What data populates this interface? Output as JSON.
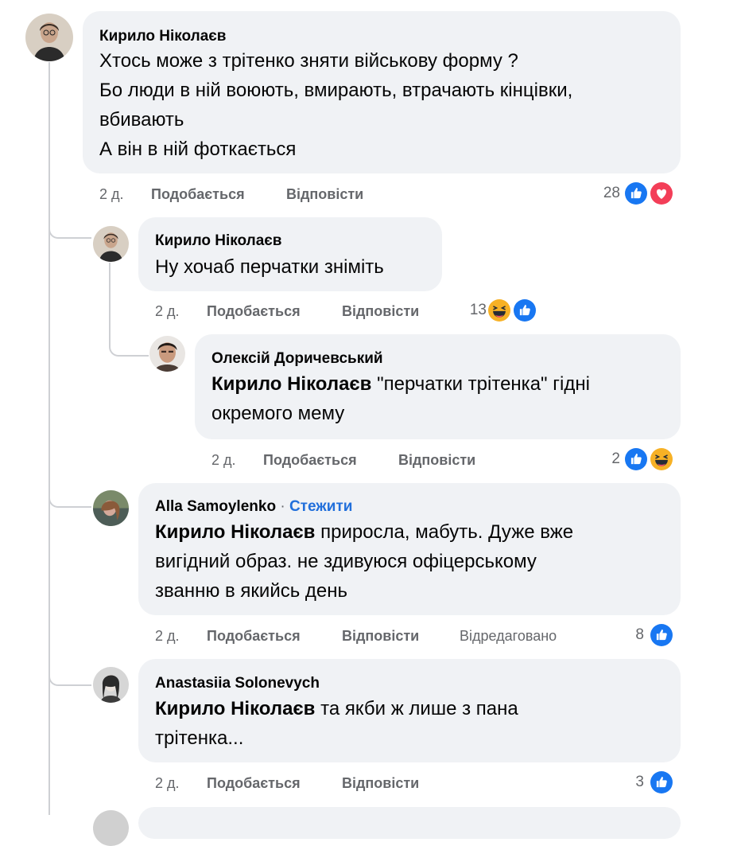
{
  "comments": [
    {
      "author": "Кирило Ніколаєв",
      "lines": [
        "Хтось може з трітенко зняти військову форму ?",
        "Бо люди в ній воюють, вмирають, втрачають кінцівки,",
        "вбивають",
        "А він в ній фоткається"
      ],
      "time": "2 д.",
      "like": "Подобається",
      "reply": "Відповісти",
      "reactions_count": "28",
      "reactions": [
        "like",
        "love"
      ]
    },
    {
      "author": "Кирило Ніколаєв",
      "lines": [
        "Ну хочаб перчатки зніміть"
      ],
      "time": "2 д.",
      "like": "Подобається",
      "reply": "Відповісти",
      "reactions_count": "13",
      "reactions": [
        "haha",
        "like"
      ]
    },
    {
      "author": "Олексій Доричевський",
      "mention": "Кирило Ніколаєв",
      "lines": [
        " \"перчатки трітенка\" гідні",
        "окремого мему"
      ],
      "time": "2 д.",
      "like": "Подобається",
      "reply": "Відповісти",
      "reactions_count": "2",
      "reactions": [
        "like",
        "haha"
      ]
    },
    {
      "author": "Alla Samoylenko",
      "follow_sep": "·",
      "follow": "Стежити",
      "mention": "Кирило Ніколаєв",
      "lines": [
        " приросла, мабуть. Дуже вже",
        "вигідний образ. не здивуюся офіцерському",
        "званню в якийсь день"
      ],
      "time": "2 д.",
      "like": "Подобається",
      "reply": "Відповісти",
      "edited": "Відредаговано",
      "reactions_count": "8",
      "reactions": [
        "like"
      ]
    },
    {
      "author": "Anastasiia Solonevych",
      "mention": "Кирило Ніколаєв",
      "lines": [
        " та якби ж лише з пана",
        "трітенка..."
      ],
      "time": "2 д.",
      "like": "Подобається",
      "reply": "Відповісти",
      "reactions_count": "3",
      "reactions": [
        "like"
      ]
    }
  ],
  "icons": {
    "like": "like-reaction-icon",
    "love": "love-reaction-icon",
    "haha": "haha-reaction-icon"
  },
  "colors": {
    "like": "#1877f2",
    "love": "#f33e58",
    "haha": "#f7b125",
    "bubble": "#f0f2f5",
    "meta": "#65676b",
    "link": "#216fdb"
  }
}
